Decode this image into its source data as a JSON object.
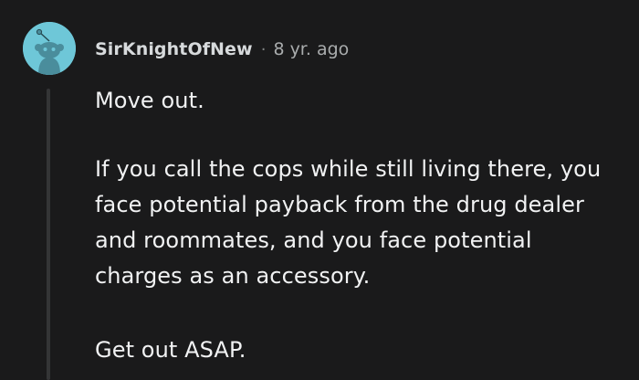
{
  "comment": {
    "author": "SirKnightOfNew",
    "separator": "·",
    "timestamp": "8 yr. ago",
    "paragraphs": [
      "Move out.",
      "If you call the cops while still living there, you face potential payback from the drug dealer and roommates, and you face potential charges as an accessory.",
      "Get out ASAP."
    ],
    "avatar_icon": "snoo-avatar-icon"
  },
  "colors": {
    "background": "#1a1a1b",
    "avatar_background": "#6ec7d8",
    "text": "#f1f2f3",
    "meta": "#a9acad",
    "thread_line": "#343536"
  }
}
